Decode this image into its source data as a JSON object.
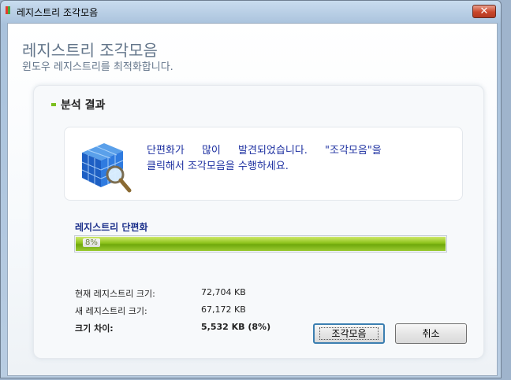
{
  "window": {
    "title": "레지스트리 조각모음",
    "close_label": "✕"
  },
  "header": {
    "title": "레지스트리 조각모음",
    "subtitle": "윈도우 레지스트리를 최적화합니다."
  },
  "results": {
    "section_title": "분석 결과",
    "message_line1": "단편화가 많이 발견되었습니다. \"조각모음\"을",
    "message_line2": "클릭해서 조각모음을 수행하세요.",
    "icon": "registry-cube-magnifier-icon"
  },
  "defrag": {
    "label": "레지스트리 단편화",
    "progress_text": "8%",
    "progress_fill_fraction": 1.0,
    "accent_color": "#8cc11b"
  },
  "stats": [
    {
      "label": "현재 레지스트리 크기:",
      "value": "72,704 KB",
      "bold": false
    },
    {
      "label": "새 레지스트리 크기:",
      "value": "67,172 KB",
      "bold": false
    },
    {
      "label": "크기 차이:",
      "value": "5,532 KB (8%)",
      "bold": true
    }
  ],
  "buttons": {
    "defrag": "조각모음",
    "cancel": "취소"
  }
}
